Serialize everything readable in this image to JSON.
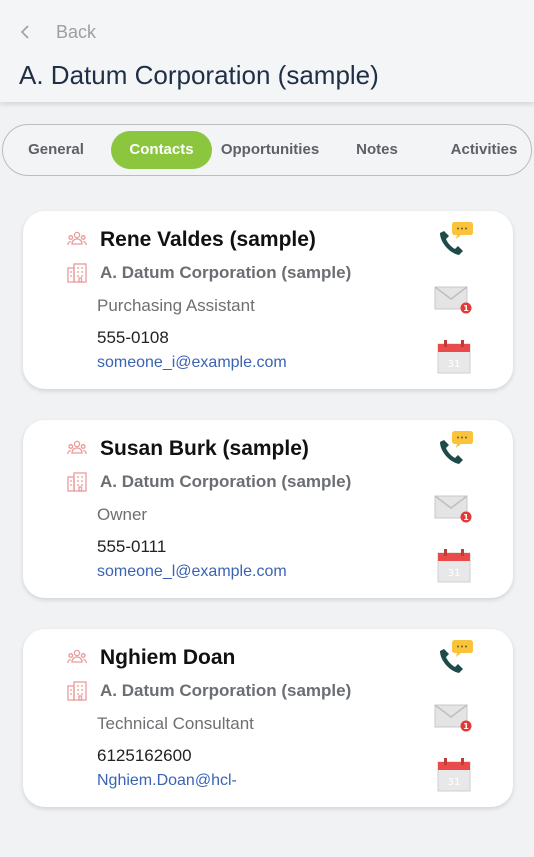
{
  "header": {
    "back_label": "Back",
    "title": "A. Datum Corporation (sample)"
  },
  "tabs": [
    {
      "label": "General"
    },
    {
      "label": "Contacts"
    },
    {
      "label": "Opportunities"
    },
    {
      "label": "Notes"
    },
    {
      "label": "Activities"
    }
  ],
  "active_tab": "Contacts",
  "contacts": [
    {
      "name": "Rene Valdes (sample)",
      "company": "A. Datum Corporation (sample)",
      "role": "Purchasing Assistant",
      "phone": "555-0108",
      "email": "someone_i@example.com"
    },
    {
      "name": "Susan Burk (sample)",
      "company": "A. Datum Corporation (sample)",
      "role": "Owner",
      "phone": "555-0111",
      "email": "someone_l@example.com"
    },
    {
      "name": "Nghiem Doan",
      "company": "A. Datum Corporation (sample)",
      "role": "Technical Consultant",
      "phone": "6125162600",
      "email": "Nghiem.Doan@hcl-"
    }
  ],
  "icons": {
    "back": "chevron-left-icon",
    "contact": "people-icon",
    "account": "building-icon",
    "call": "phone-call-icon",
    "email": "envelope-icon",
    "appointment": "calendar-icon"
  },
  "calendar_day": "31",
  "colors": {
    "accent": "#8cc63f",
    "link": "#3b63b4",
    "title": "#1f2f45",
    "badge": "#e53935",
    "chat": "#f9c43b",
    "phone": "#1f4a4a"
  }
}
